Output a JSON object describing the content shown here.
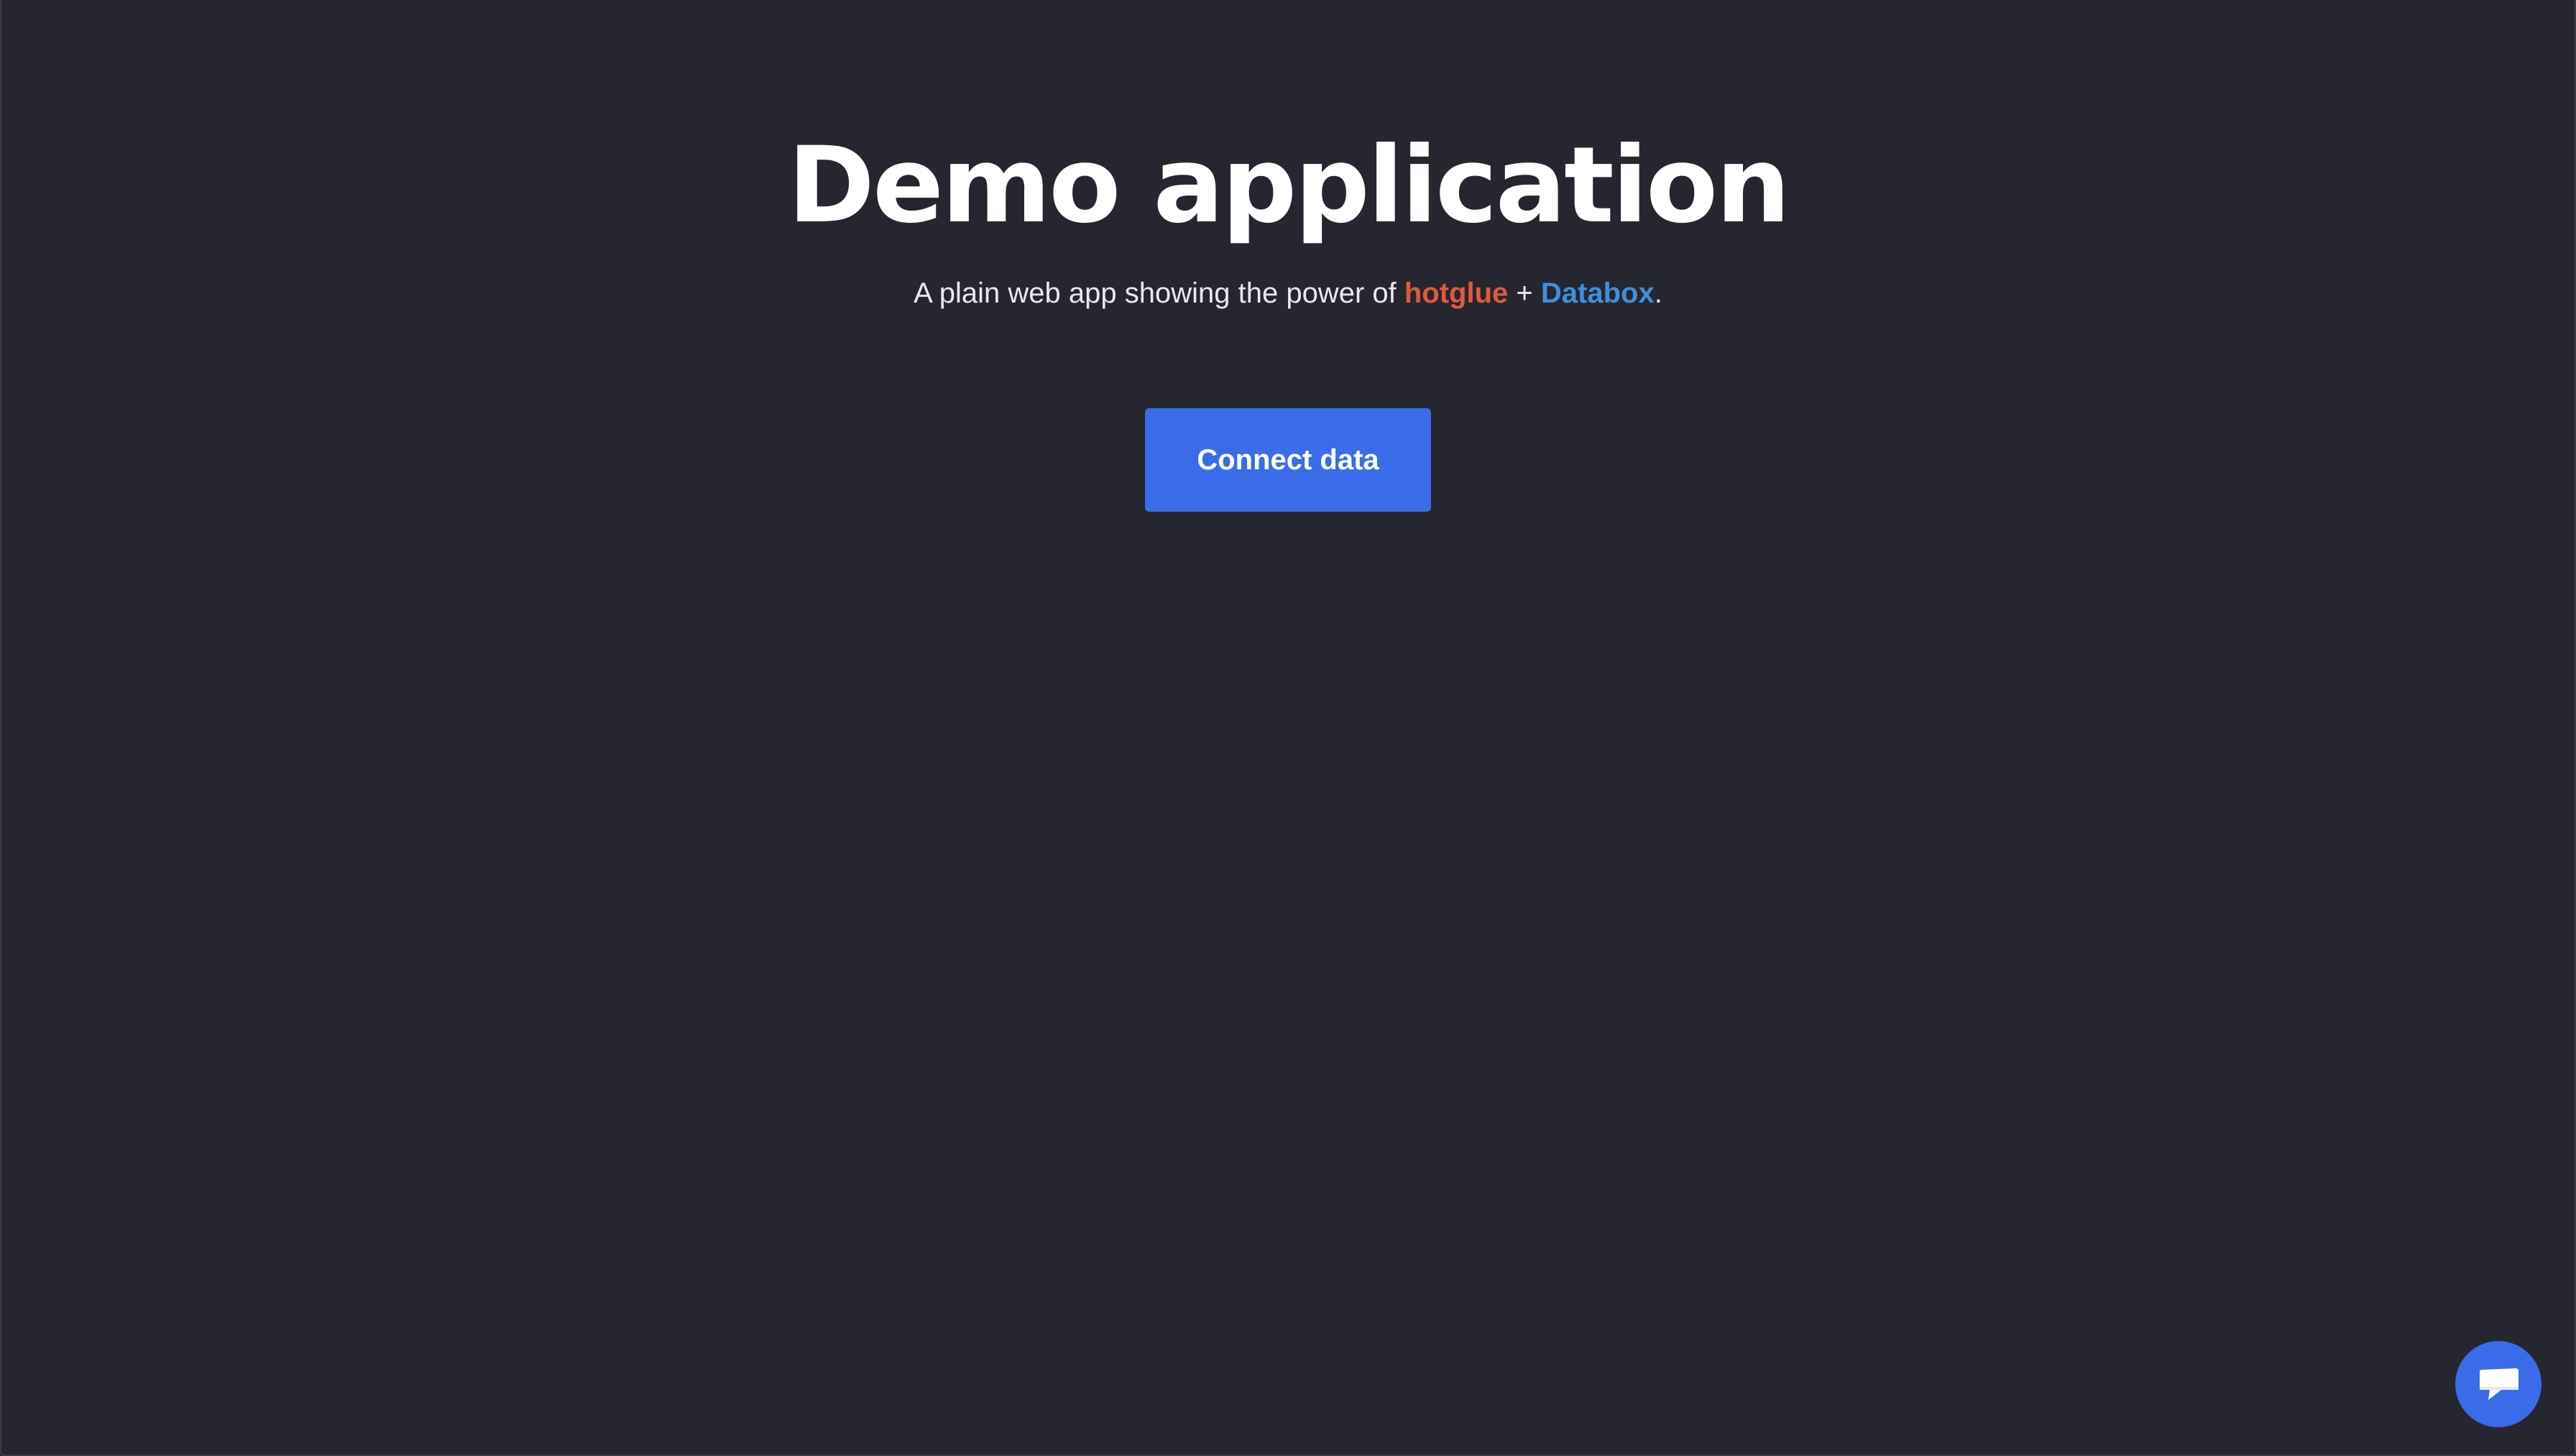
{
  "hero": {
    "title": "Demo application",
    "subtitle_prefix": "A plain web app showing the power of ",
    "brand_one": "hotglue",
    "separator": " + ",
    "brand_two": "Databox",
    "subtitle_suffix": "."
  },
  "actions": {
    "connect_label": "Connect data"
  },
  "icons": {
    "chat": "chat-bubble-icon"
  },
  "colors": {
    "background": "#262630",
    "primary": "#3a6be8",
    "hotglue": "#e0593e",
    "databox": "#3f8fd9"
  }
}
